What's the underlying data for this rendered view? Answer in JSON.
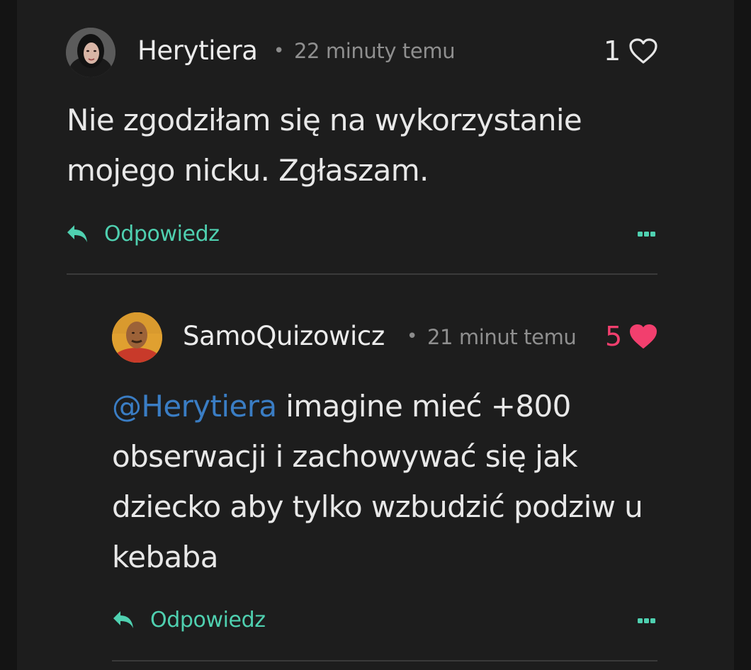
{
  "comments": [
    {
      "author": "Herytiera",
      "separator": "•",
      "time": "22 minuty temu",
      "likes": "1",
      "liked": false,
      "text_lines": [
        "Nie zgodziłam się na wykorzystanie",
        "mojego nicku. Zgłaszam."
      ],
      "reply_label": "Odpowiedz",
      "reply_icon": "reply-arrow-icon",
      "more_icon": "more-dots-icon"
    },
    {
      "author": "SamoQuizowicz",
      "separator": "•",
      "time": "21 minut temu",
      "likes": "5",
      "liked": true,
      "mention": "@Herytiera",
      "text_line1_rest": " imagine mieć +800",
      "text_lines_rest": [
        "obserwacji i zachowywać się jak",
        "dziecko aby tylko wzbudzić podziw u",
        "kebaba"
      ],
      "reply_label": "Odpowiedz",
      "reply_icon": "reply-arrow-icon",
      "more_icon": "more-dots-icon"
    }
  ],
  "colors": {
    "background": "#1d1d1d",
    "accent": "#4fd0b0",
    "mention": "#3a7dc4",
    "liked_heart": "#f23f6e",
    "text": "#e8e8e8",
    "muted": "#8f8f8f"
  }
}
